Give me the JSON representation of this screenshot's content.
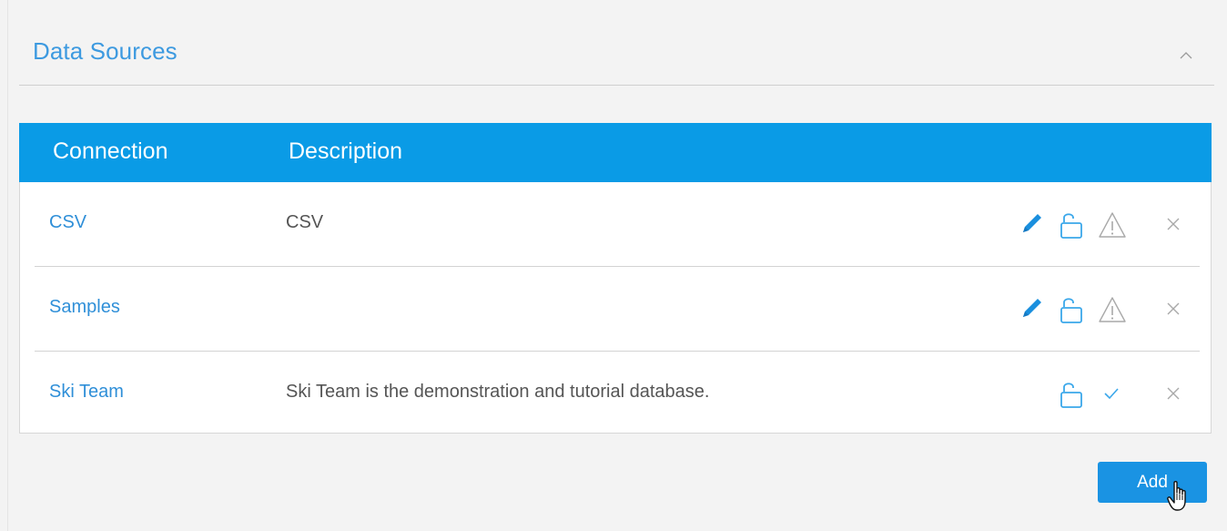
{
  "panel": {
    "title": "Data Sources",
    "collapse_icon": "chevron-up-icon"
  },
  "table": {
    "columns": [
      "Connection",
      "Description"
    ],
    "rows": [
      {
        "connection": "CSV",
        "description": "CSV",
        "icons": [
          "pencil-icon",
          "unlock-icon",
          "warning-icon",
          "close-icon"
        ]
      },
      {
        "connection": "Samples",
        "description": "",
        "icons": [
          "pencil-icon",
          "unlock-icon",
          "warning-icon",
          "close-icon"
        ]
      },
      {
        "connection": "Ski Team",
        "description": "Ski Team is the demonstration and tutorial database.",
        "icons": [
          "unlock-icon",
          "check-icon",
          "close-icon"
        ]
      }
    ]
  },
  "actions": {
    "add_label": "Add"
  },
  "colors": {
    "accent": "#0a9be6",
    "link": "#2f8fd8",
    "button": "#1a93e3",
    "icon_muted": "#b5b5b5",
    "background": "#f3f3f3"
  }
}
